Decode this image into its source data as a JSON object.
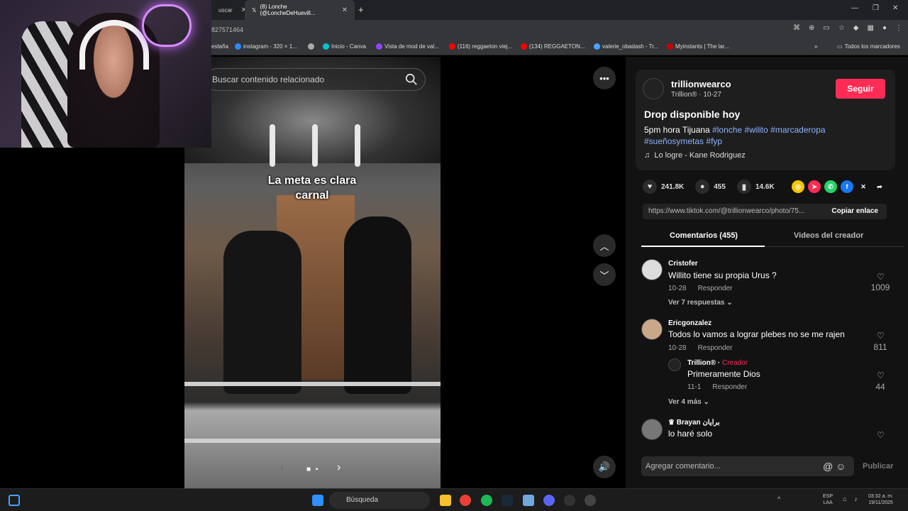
{
  "browser": {
    "tabs": [
      {
        "label": "uscar",
        "active": false
      },
      {
        "label": "(8) Lonche (@LoncheDeHuevill...",
        "active": true
      },
      {
        "label": "+",
        "active": false
      }
    ],
    "url": "827571464",
    "bookmarks": [
      "estaña",
      "instagram - 320 × 1...",
      "Inicio - Canva",
      "Vista de mod de val...",
      "(116) reggaeton viej...",
      "(134) REGGAETON...",
      "valerie_obadash - Tr...",
      "Myinstants | The lar...",
      "Todos los marcadores"
    ]
  },
  "video": {
    "search_placeholder": "Buscar contenido relacionado",
    "caption": "La meta es clara carnal"
  },
  "post": {
    "username": "trillionwearco",
    "subline": "Trillion® · 10-27",
    "follow_label": "Seguir",
    "title": "Drop disponible hoy",
    "desc_text": "5pm hora Tijuana ",
    "tags": [
      "#lonche",
      "#wilito",
      "#marcaderopa",
      "#sueñosymetas",
      "#fyp"
    ],
    "music": "Lo logre - Kane Rodriguez",
    "likes": "241.8K",
    "comments": "455",
    "saves": "14.6K",
    "link": "https://www.tiktok.com/@trillionwearco/photo/75...",
    "copy_label": "Copiar enlace",
    "tab_comments": "Comentarios (455)",
    "tab_videos": "Videos del creador"
  },
  "comments": [
    {
      "name": "Cristofer",
      "text": "Willito tiene su propia Urus ?",
      "date": "10-28",
      "reply": "Responder",
      "likes": "1009",
      "more": "Ver 7 respuestas"
    },
    {
      "name": "Ericgonzalez",
      "text": "Todos lo vamos a lograr plebes no se me rajen",
      "date": "10-28",
      "reply": "Responder",
      "likes": "811"
    },
    {
      "name": "Trillion®",
      "creator": "Creador",
      "text": "Primeramente Dios",
      "date": "11-1",
      "reply": "Responder",
      "likes": "44",
      "more": "Ver 4 más"
    },
    {
      "name": "Brayan",
      "name_suffix": "برايان",
      "text": "lo haré solo"
    }
  ],
  "composer": {
    "placeholder": "Agregar comentario...",
    "publish": "Publicar"
  },
  "taskbar": {
    "search": "Búsqueda",
    "lang": "ESP",
    "lang2": "LAA",
    "time": "03:32 a. m.",
    "date": "19/11/2025"
  }
}
